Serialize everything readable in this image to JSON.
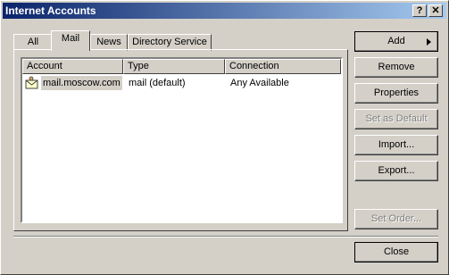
{
  "window": {
    "title": "Internet Accounts",
    "help_label": "?",
    "close_label": "✕"
  },
  "tabs": [
    {
      "label": "All",
      "active": false
    },
    {
      "label": "Mail",
      "active": true
    },
    {
      "label": "News",
      "active": false
    },
    {
      "label": "Directory Service",
      "active": false
    }
  ],
  "list": {
    "columns": [
      "Account",
      "Type",
      "Connection"
    ],
    "rows": [
      {
        "account": "mail.moscow.com",
        "type": "mail (default)",
        "connection": "Any Available",
        "icon": "mail-account-icon"
      }
    ]
  },
  "buttons": {
    "add": "Add",
    "remove": "Remove",
    "properties": "Properties",
    "set_default": "Set as Default",
    "import": "Import...",
    "export": "Export...",
    "set_order": "Set Order...",
    "close": "Close"
  },
  "colors": {
    "title_start": "#0a246a",
    "title_end": "#a6caf0",
    "face": "#d4d0c8",
    "disabled_text": "#808080"
  }
}
